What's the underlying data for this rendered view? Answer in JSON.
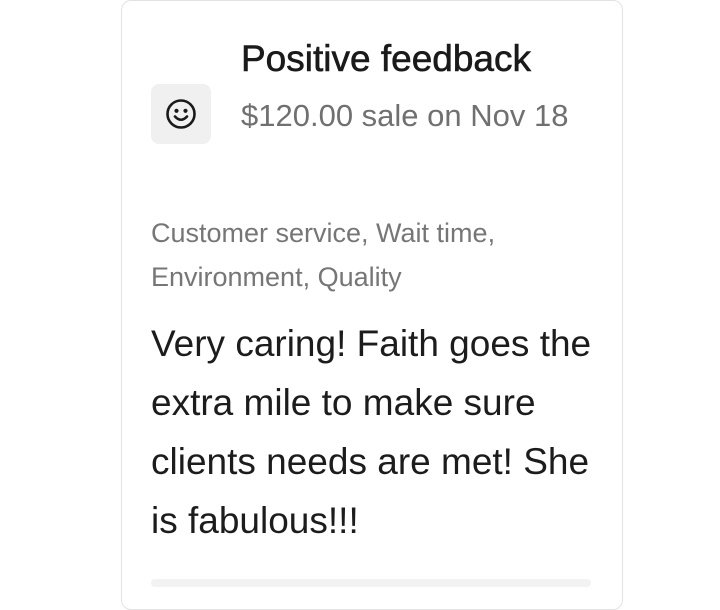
{
  "feedback": {
    "title": "Positive feedback",
    "sale_summary": "$120.00 sale on Nov 18",
    "icon": "smiley-face-icon",
    "tags": "Customer service, Wait time, Environment, Quality",
    "comment": "Very caring! Faith goes the extra mile to make sure clients needs are met! She is fabulous!!!"
  },
  "colors": {
    "title": "#1a1a1a",
    "secondary_text": "#707070",
    "icon_background": "#f0f0f0",
    "card_border": "#e3e3e3"
  }
}
